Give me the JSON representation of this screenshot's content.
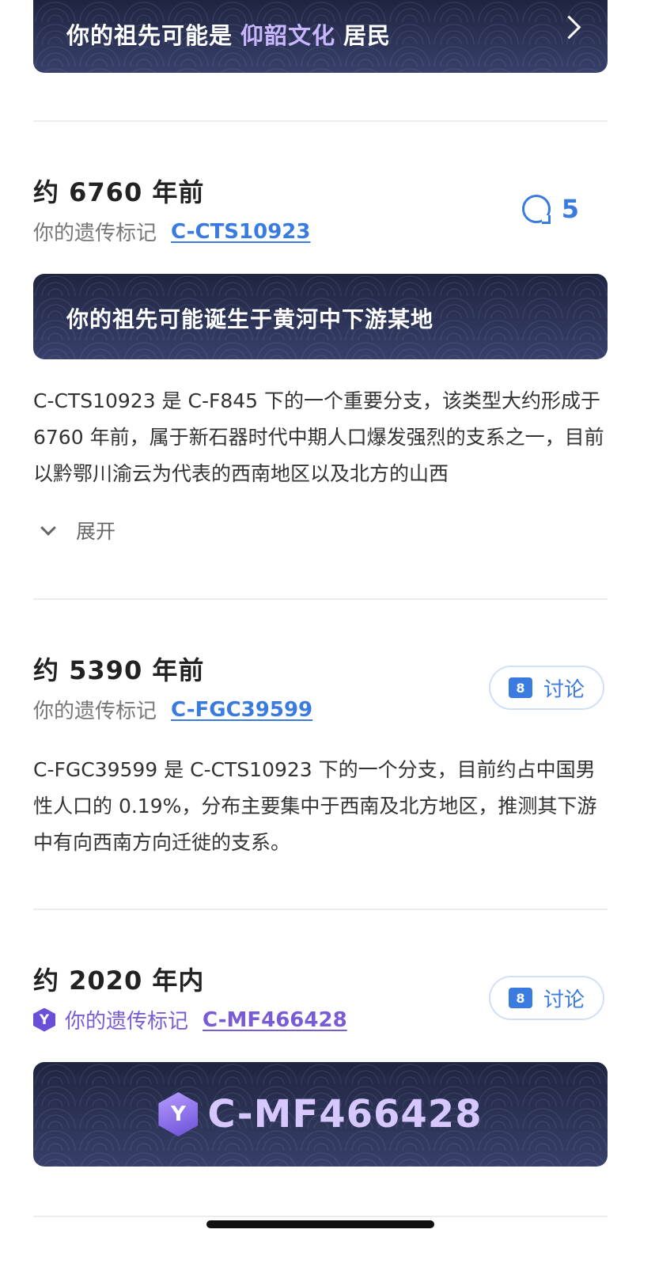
{
  "top_banner": {
    "prefix": "你的祖先可能是",
    "culture": "仰韶文化",
    "suffix": "居民"
  },
  "sections": [
    {
      "era": "约 6760 年前",
      "marker_label": "你的遗传标记",
      "marker_code": "C-CTS10923",
      "comment_count": "5",
      "banner_text": "你的祖先可能诞生于黄河中下游某地",
      "description": "C-CTS10923 是 C-F845 下的一个重要分支，该类型大约形成于 6760 年前，属于新石器时代中期人口爆发强烈的支系之一，目前以黔鄂川渝云为代表的西南地区以及北方的山西",
      "expand_label": "展开"
    },
    {
      "era": "约 5390 年前",
      "marker_label": "你的遗传标记",
      "marker_code": "C-FGC39599",
      "discuss_label": "讨论",
      "description": "C-FGC39599 是 C-CTS10923 下的一个分支，目前约占中国男性人口的 0.19%，分布主要集中于西南及北方地区，推测其下游中有向西南方向迁徙的支系。"
    },
    {
      "era": "约 2020 年内",
      "badge_letter": "Y",
      "marker_label": "你的遗传标记",
      "marker_code": "C-MF466428",
      "discuss_label": "讨论",
      "banner_code": "C-MF466428"
    }
  ],
  "colors": {
    "accent": "#3a7be0",
    "purple": "#7a5bd6",
    "banner_bg": "#2a3150"
  }
}
